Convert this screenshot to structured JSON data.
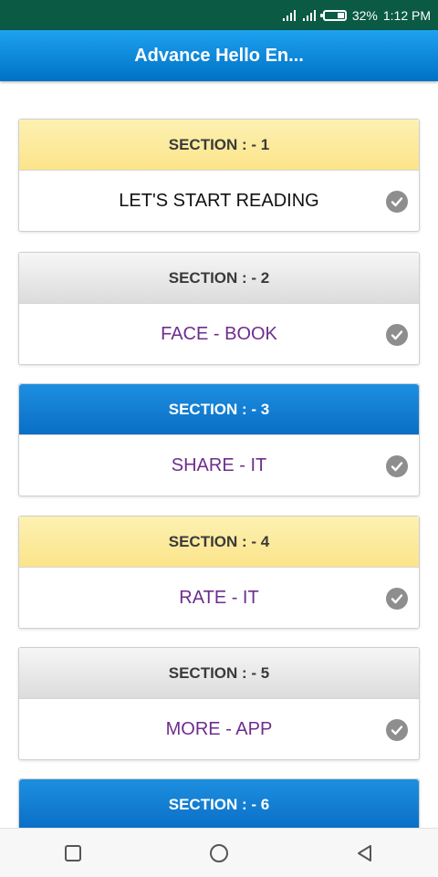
{
  "status_bar": {
    "battery_percent": "32%",
    "time": "1:12 PM",
    "icons": [
      "signal-icon",
      "signal-icon",
      "battery-icon"
    ]
  },
  "app_bar": {
    "title": "Advance Hello En..."
  },
  "sections": [
    {
      "header": "SECTION : - 1",
      "label": "LET'S START READING",
      "header_style": "yellow",
      "label_color": "#111111",
      "icon": "check-circle-icon"
    },
    {
      "header": "SECTION : - 2",
      "label": "FACE - BOOK",
      "header_style": "gray",
      "label_color": "#6e2d8e",
      "icon": "check-circle-icon"
    },
    {
      "header": "SECTION : - 3",
      "label": "SHARE - IT",
      "header_style": "blue",
      "label_color": "#6e2d8e",
      "icon": "check-circle-icon"
    },
    {
      "header": "SECTION : - 4",
      "label": "RATE - IT",
      "header_style": "yellow",
      "label_color": "#6e2d8e",
      "icon": "check-circle-icon"
    },
    {
      "header": "SECTION : - 5",
      "label": "MORE - APP",
      "header_style": "gray",
      "label_color": "#6e2d8e",
      "icon": "check-circle-icon"
    },
    {
      "header": "SECTION : - 6",
      "label": "",
      "header_style": "blue",
      "label_color": "#6e2d8e",
      "icon": "check-circle-icon"
    }
  ],
  "nav_bar": {
    "buttons": [
      "recent-apps-icon",
      "home-icon",
      "back-icon"
    ]
  },
  "colors": {
    "status_bar": "#0a5a44",
    "app_bar": "#0a85d6",
    "header_yellow": "#fbe48a",
    "header_gray": "#dcdcdc",
    "header_blue": "#0a6ec6",
    "label_purple": "#6e2d8e"
  }
}
